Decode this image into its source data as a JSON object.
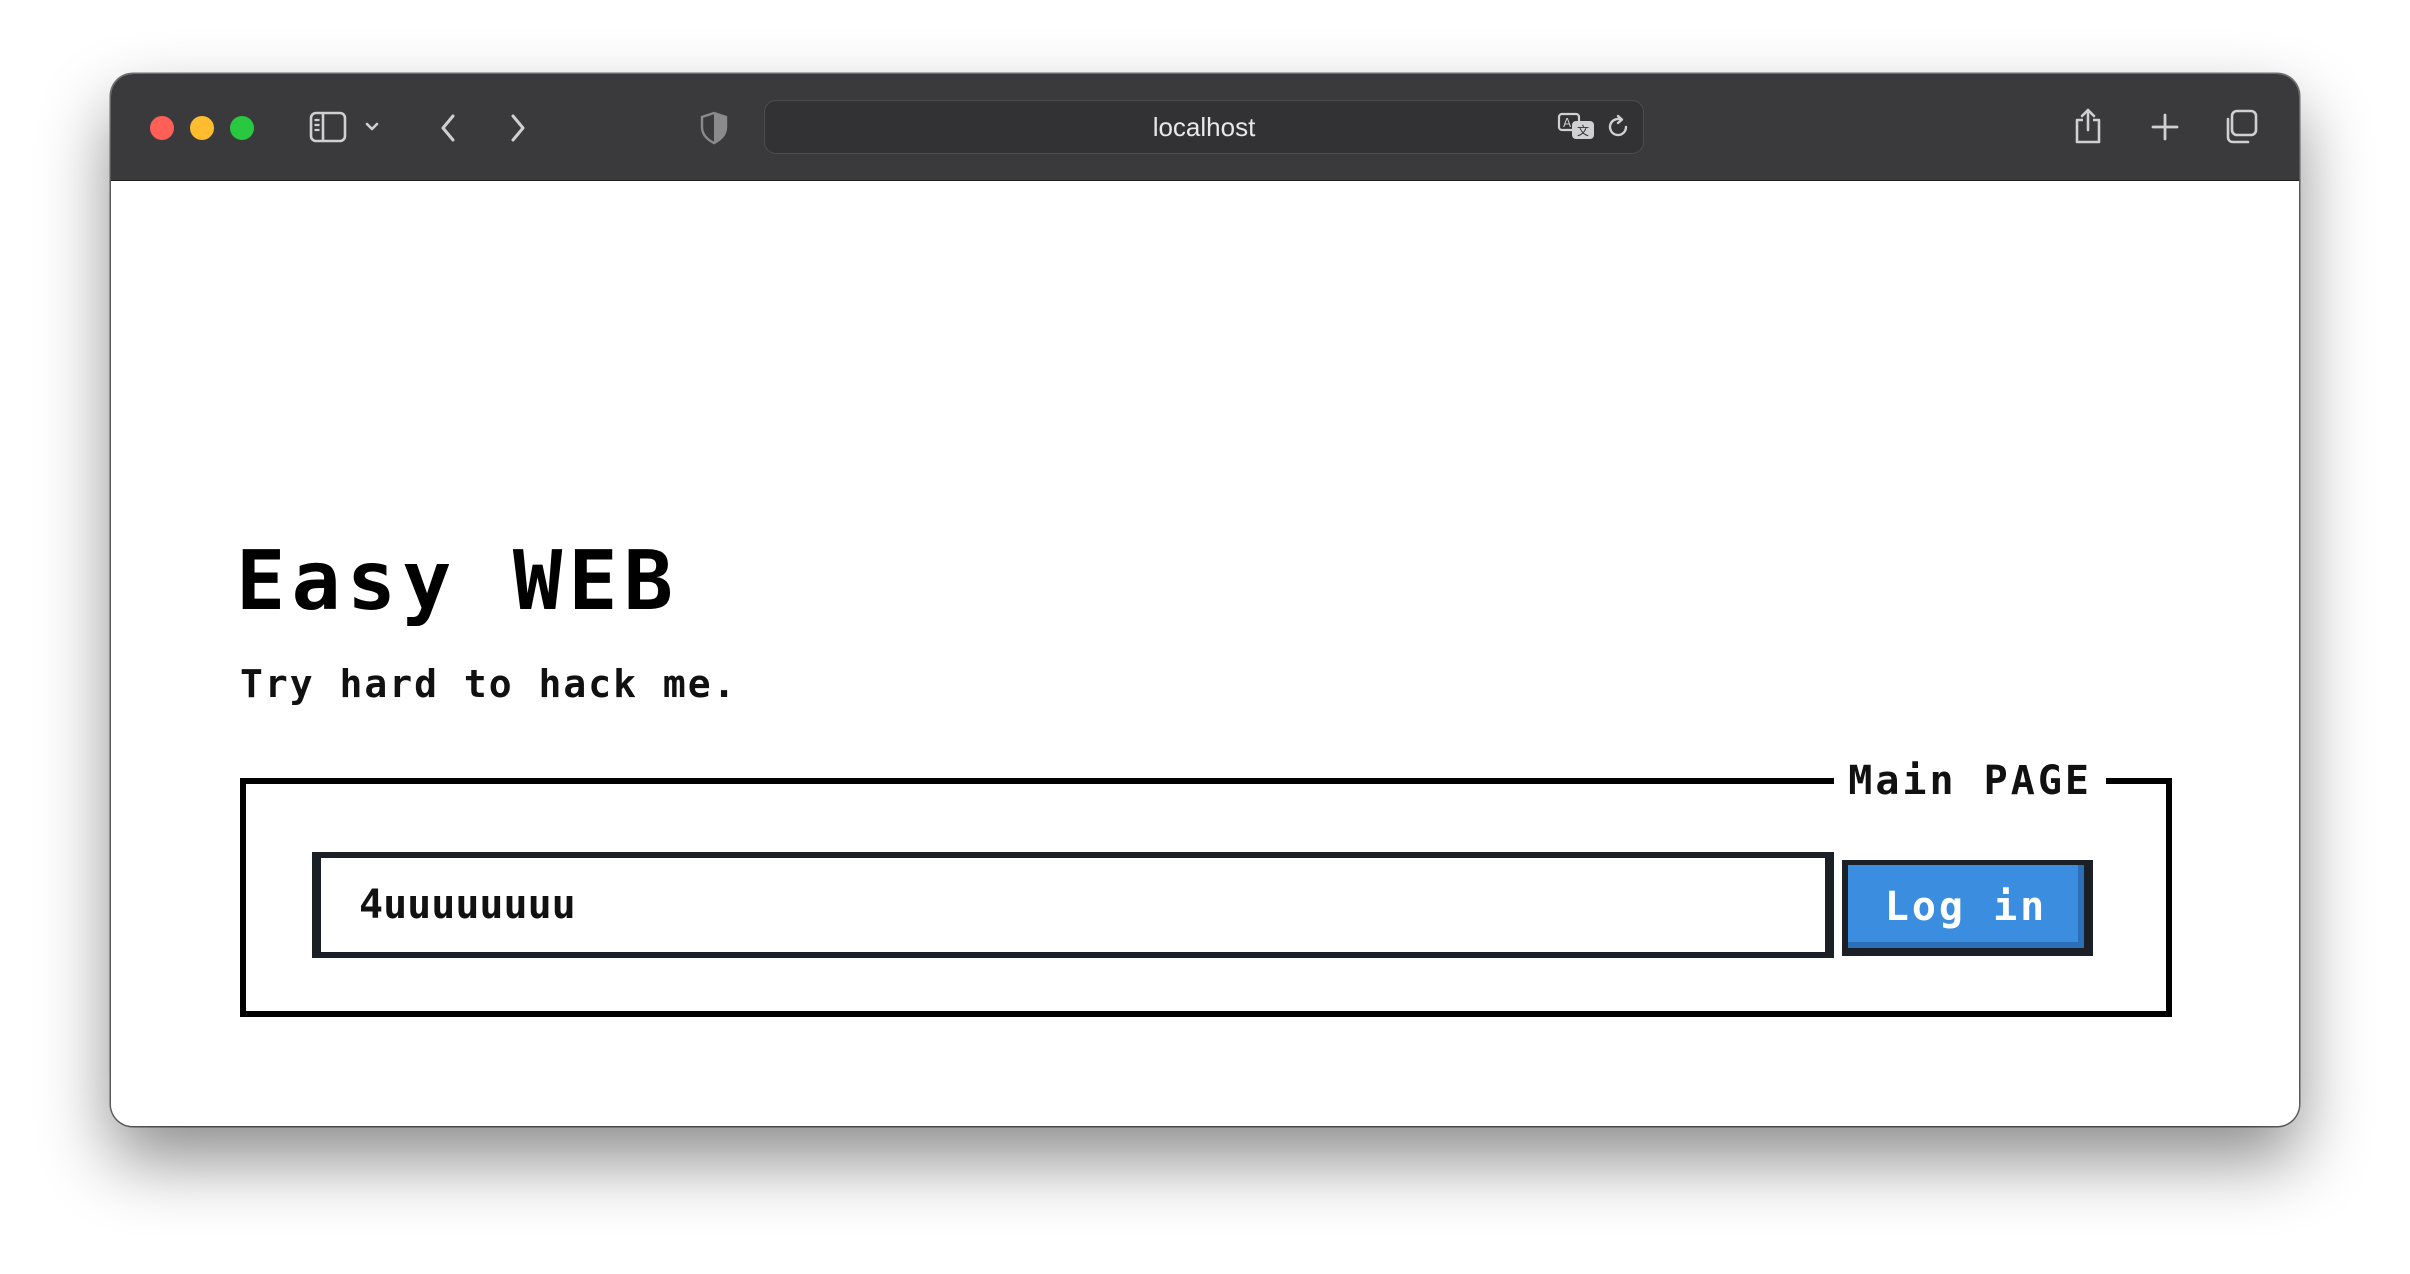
{
  "browser": {
    "url": "localhost",
    "icons": {
      "sidebar": "sidebar-icon",
      "sidebar_menu": "chevron-down-icon",
      "back": "chevron-left-icon",
      "forward": "chevron-right-icon",
      "privacy": "shield-icon",
      "translate": "translate-icon",
      "reload": "reload-icon",
      "share": "share-icon",
      "new_tab": "plus-icon",
      "tab_overview": "tabs-icon"
    }
  },
  "page": {
    "title": "Easy WEB",
    "subtitle": "Try hard to hack me.",
    "panel_legend": "Main PAGE",
    "input_value": "4uuuuuuuu",
    "login_label": "Log in"
  },
  "colors": {
    "button": "#3b8de0",
    "border": "#1b1f26",
    "titlebar": "#3a3a3c"
  }
}
